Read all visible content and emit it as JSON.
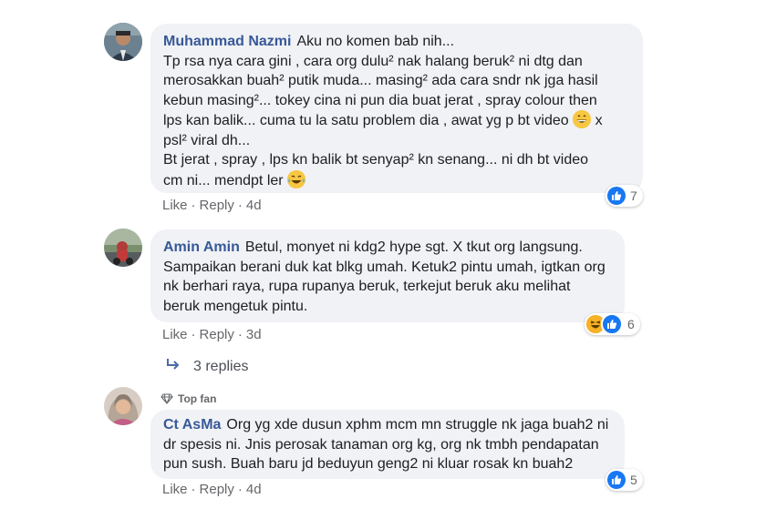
{
  "comments": [
    {
      "author": "Muhammad Nazmi",
      "lines": [
        "Aku no komen bab nih...",
        "Tp rsa nya cara gini , cara org dulu² nak halang beruk² ni dtg dan",
        "merosakkan buah² putik muda... masing² ada cara sndr nk jga hasil",
        "kebun masing²... tokey cina ni pun dia buat jerat , spray colour then",
        "lps kan balik... cuma tu la satu problem dia , awat yg p bt video",
        "x",
        "psl² viral dh...",
        "Bt jerat , spray , lps kn balik bt senyap² kn senang... ni dh bt video",
        "cm ni... mendpt ler"
      ],
      "emoji_1": "grin-emoji",
      "emoji_2": "tears-of-joy-emoji",
      "like": "Like",
      "reply": "Reply",
      "time": "4d",
      "reaction_count": "7",
      "reaction_icons": [
        "like-icon"
      ]
    },
    {
      "author": "Amin Amin",
      "lines": [
        "Betul, monyet ni kdg2 hype sgt. X tkut org langsung.",
        "Sampaikan berani duk kat blkg umah. Ketuk2 pintu umah, igtkan org",
        "nk berhari raya, rupa rupanya beruk, terkejut beruk aku melihat",
        "beruk mengetuk pintu."
      ],
      "like": "Like",
      "reply": "Reply",
      "time": "3d",
      "reaction_count": "6",
      "reaction_icons": [
        "haha-icon",
        "like-icon"
      ],
      "replies_label": "3 replies"
    },
    {
      "badge": "Top fan",
      "author": "Ct AsMa",
      "lines": [
        "Org yg xde dusun xphm mcm mn struggle nk jaga buah2 ni",
        "dr spesis ni. Jnis perosak tanaman org kg, org nk tmbh pendapatan",
        "pun sush. Buah baru jd beduyun geng2 ni kluar rosak kn buah2"
      ],
      "like": "Like",
      "reply": "Reply",
      "time": "4d",
      "reaction_count": "5",
      "reaction_icons": [
        "like-icon"
      ]
    }
  ],
  "colors": {
    "author": "#385898",
    "bubble": "#f0f2f5",
    "like_blue": "#1877f2",
    "meta": "#65676b"
  }
}
